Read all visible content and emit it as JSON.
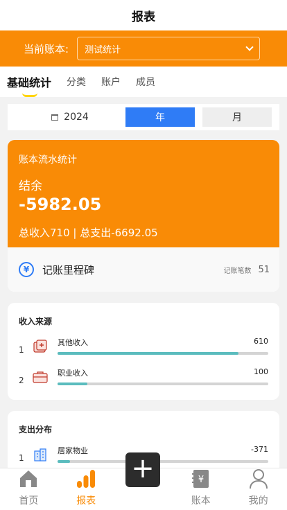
{
  "header": {
    "title": "报表"
  },
  "book": {
    "label": "当前账本:",
    "selected": "测试统计"
  },
  "tabs": [
    {
      "label": "基础统计",
      "active": true
    },
    {
      "label": "分类"
    },
    {
      "label": "账户"
    },
    {
      "label": "成员"
    }
  ],
  "period": {
    "year": "2024",
    "seg_year": "年",
    "seg_month": "月"
  },
  "flow": {
    "title": "账本流水统计",
    "balance_label": "结余",
    "balance": "-5982.05",
    "summary": "总收入710 | 总支出-6692.05",
    "milestone_label": "记账里程碑",
    "count_label": "记账笔数",
    "count": "51"
  },
  "income": {
    "title": "收入来源",
    "items": [
      {
        "rank": "1",
        "name": "其他收入",
        "value": "610",
        "fraction": 0.86,
        "icon": "red-envelope-icon"
      },
      {
        "rank": "2",
        "name": "职业收入",
        "value": "100",
        "fraction": 0.14,
        "icon": "briefcase-icon"
      }
    ]
  },
  "expense": {
    "title": "支出分布",
    "items": [
      {
        "rank": "1",
        "name": "居家物业",
        "value": "-371",
        "fraction": 0.06,
        "icon": "building-icon"
      }
    ]
  },
  "tabbar": {
    "home": "首页",
    "report": "报表",
    "book": "账本",
    "mine": "我的",
    "add_icon": "plus-icon"
  },
  "colors": {
    "brand_orange": "#f98b06",
    "accent_blue": "#2f7cf6",
    "bar_teal": "#5bbcbe"
  }
}
